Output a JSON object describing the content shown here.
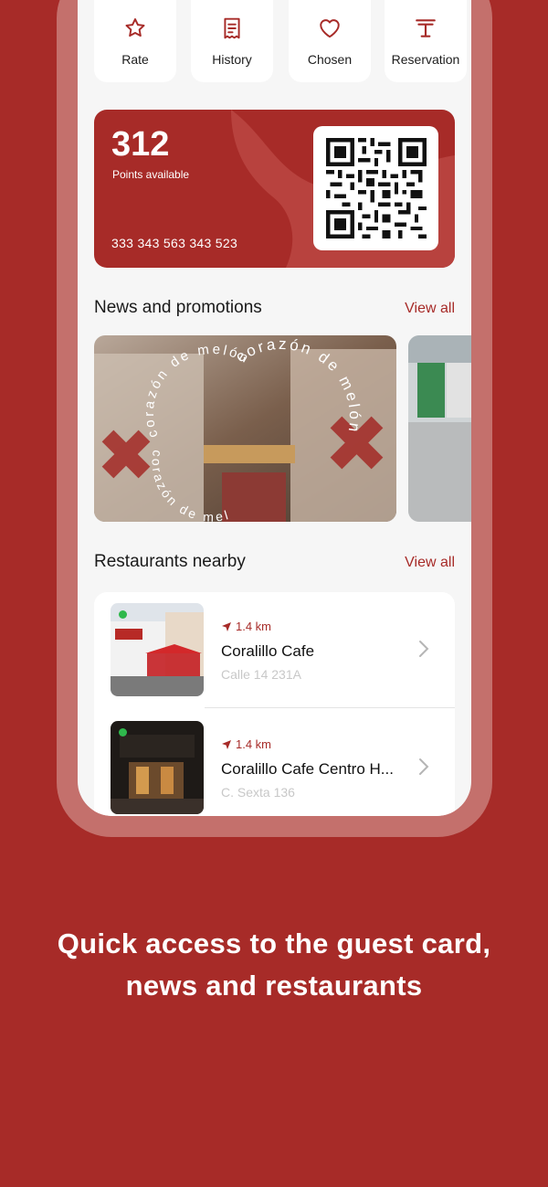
{
  "quick_actions": [
    {
      "label": "Rate",
      "icon": "star-icon"
    },
    {
      "label": "History",
      "icon": "receipt-icon"
    },
    {
      "label": "Chosen",
      "icon": "heart-icon"
    },
    {
      "label": "Reservation",
      "icon": "table-icon"
    }
  ],
  "guest_card": {
    "points": "312",
    "points_label": "Points available",
    "card_number": "333 343 563 343 523",
    "qr_icon": "qr-code-icon"
  },
  "news": {
    "title": "News and promotions",
    "view_all": "View all",
    "items": [
      {
        "overlay_text": "corazón de melón"
      },
      {
        "overlay_text": ""
      }
    ]
  },
  "restaurants": {
    "title": "Restaurants nearby",
    "view_all": "View all",
    "items": [
      {
        "distance": "1.4 km",
        "name": "Coralillo Cafe",
        "address": "Calle 14 231A",
        "status": "open"
      },
      {
        "distance": "1.4 km",
        "name": "Coralillo Cafe Centro H...",
        "address": "C. Sexta 136",
        "status": "open"
      }
    ]
  },
  "caption": {
    "line1": "Quick access to the guest card,",
    "line2": "news and restaurants"
  },
  "colors": {
    "brand": "#a72b28",
    "frame": "#c4706c",
    "screen": "#f6f6f6",
    "status_open": "#2fb84c"
  }
}
